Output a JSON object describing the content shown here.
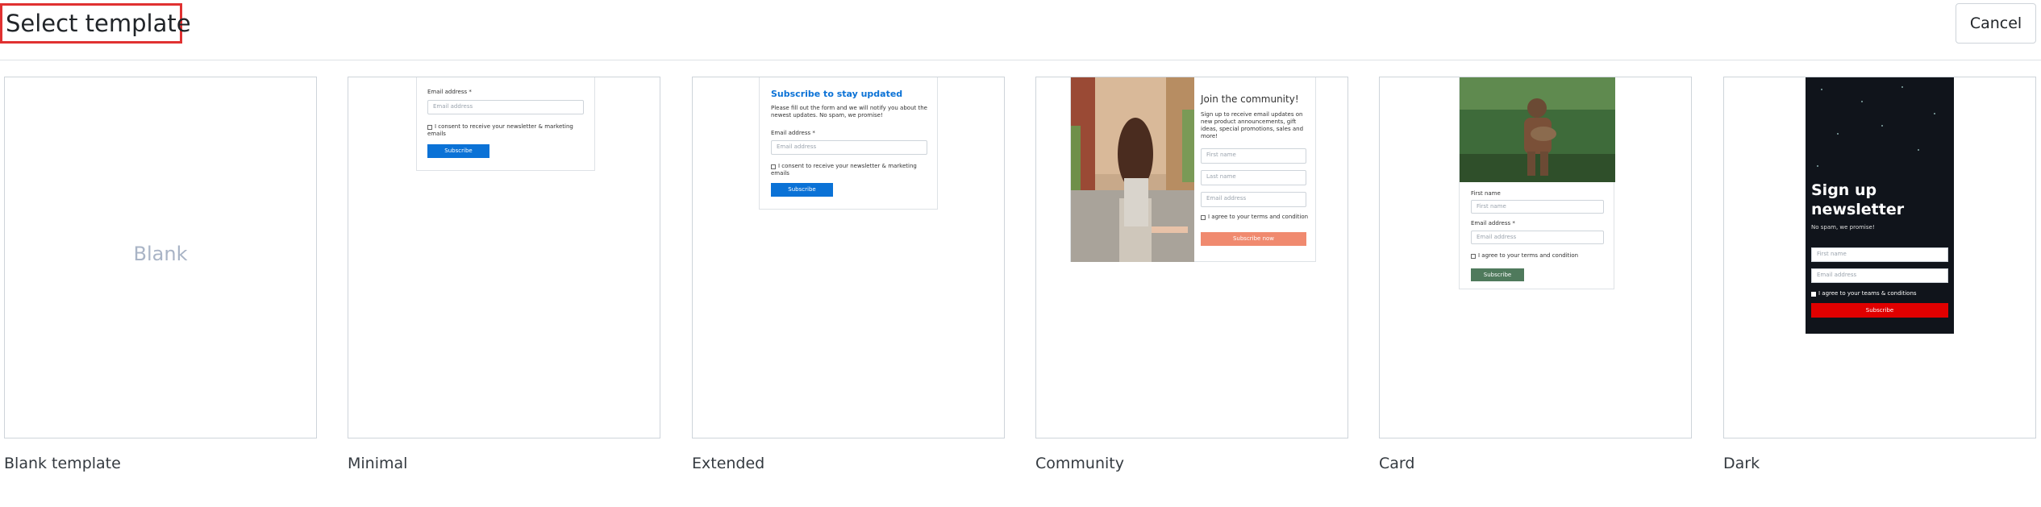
{
  "header": {
    "title": "Select template",
    "cancel_label": "Cancel"
  },
  "templates": [
    {
      "name": "Blank template",
      "preview_text": "Blank"
    },
    {
      "name": "Minimal",
      "email_label": "Email address *",
      "email_placeholder": "Email address",
      "consent": "I consent to receive your newsletter & marketing emails",
      "button": "Subscribe"
    },
    {
      "name": "Extended",
      "heading": "Subscribe to stay updated",
      "intro": "Please fill out the form and we will notify you about the newest updates. No spam, we promise!",
      "email_label": "Email address *",
      "email_placeholder": "Email address",
      "consent": "I consent to receive your newsletter & marketing emails",
      "button": "Subscribe"
    },
    {
      "name": "Community",
      "heading": "Join the community!",
      "intro": "Sign up to receive email updates on new product announcements, gift ideas, special promotions, sales and more!",
      "first_placeholder": "First name",
      "last_placeholder": "Last name",
      "email_placeholder": "Email address",
      "terms": "I agree to your terms and condition",
      "button": "Subscribe now"
    },
    {
      "name": "Card",
      "first_label": "First name",
      "first_placeholder": "First name",
      "email_label": "Email address *",
      "email_placeholder": "Email address",
      "terms": "I agree to your terms and condition",
      "button": "Subscribe"
    },
    {
      "name": "Dark",
      "heading": "Sign up newsletter",
      "intro": "No spam, we promise!",
      "first_placeholder": "First name",
      "email_placeholder": "Email address",
      "terms": "I agree to your teams & conditions",
      "button": "Subscribe"
    }
  ],
  "colors": {
    "primary": "#0b72d6",
    "community_button": "#f08a6f",
    "card_button": "#4f7a5c",
    "dark_bg": "#10141b",
    "dark_button": "#e00000",
    "title_highlight": "#e03131"
  }
}
